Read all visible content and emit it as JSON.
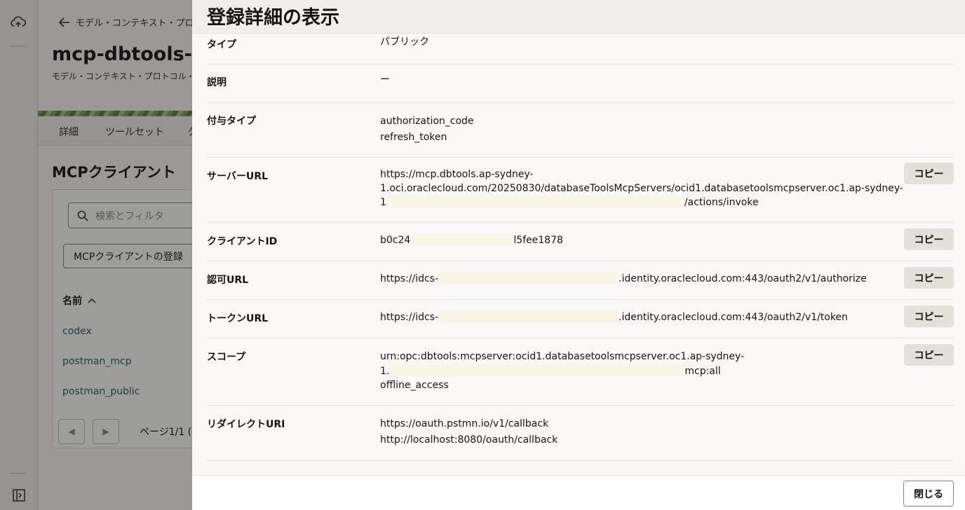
{
  "background": {
    "back_link": "モデル・コンテキスト・プロトコル",
    "page_title": "mcp-dbtools-ad",
    "page_subtitle": "モデル・コンテキスト・プロトコル・",
    "tabs": [
      "詳細",
      "ツールセット",
      "ク"
    ],
    "section_title": "MCPクライアント",
    "search_placeholder": "検索とフィルタ",
    "register_button": "MCPクライアントの登録",
    "column_name": "名前",
    "clients": [
      "codex",
      "postman_mcp",
      "postman_public"
    ],
    "page_info": "ページ1/1 ("
  },
  "drawer": {
    "title": "登録詳細の表示",
    "copy_label": "コピー",
    "close_label": "閉じる",
    "rows": {
      "type": {
        "label": "タイプ",
        "value": "パブリック"
      },
      "description": {
        "label": "説明",
        "value": "ー"
      },
      "grant": {
        "label": "付与タイプ",
        "values": [
          "authorization_code",
          "refresh_token"
        ]
      },
      "server": {
        "label": "サーバーURL",
        "line1": "https://mcp.dbtools.ap-sydney-",
        "line2": "1.oci.oraclecloud.com/20250830/databaseToolsMcpServers/ocid1.databasetoolsmcpserver.oc1.ap-sydney-",
        "line3_prefix": "1",
        "line3_suffix": "/actions/invoke"
      },
      "client_id": {
        "label": "クライアントID",
        "prefix": "b0c24",
        "suffix": "l5fee1878"
      },
      "auth_url": {
        "label": "認可URL",
        "prefix": "https://idcs-",
        "suffix": ".identity.oraclecloud.com:443/oauth2/v1/authorize"
      },
      "token_url": {
        "label": "トークンURL",
        "prefix": "https://idcs-",
        "suffix": ".identity.oraclecloud.com:443/oauth2/v1/token"
      },
      "scope": {
        "label": "スコープ",
        "line1": "urn:opc:dbtools:mcpserver:ocid1.databasetoolsmcpserver.oc1.ap-sydney-",
        "line2_prefix": "1.",
        "line2_suffix": "mcp:all",
        "line3": "offline_access"
      },
      "redirect": {
        "label": "リダイレクトURI",
        "values": [
          "https://oauth.pstmn.io/v1/callback",
          "http://localhost:8080/oauth/callback"
        ]
      }
    }
  }
}
